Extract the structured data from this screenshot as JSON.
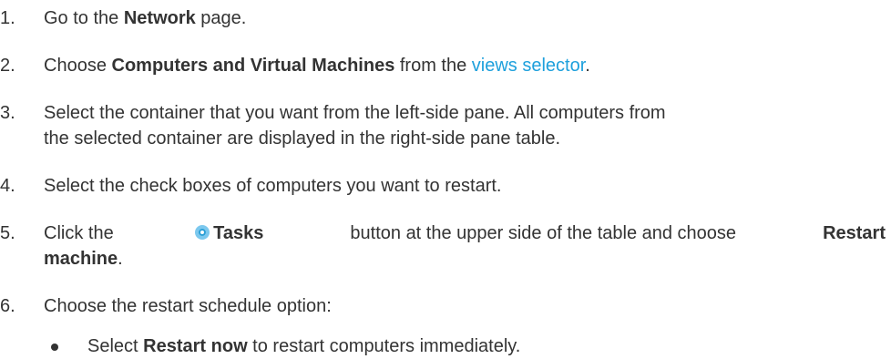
{
  "steps": [
    {
      "num": "1.",
      "pre": "Go to the ",
      "bold": "Network",
      "post": " page."
    },
    {
      "num": "2.",
      "pre": "Choose ",
      "bold": "Computers and Virtual Machines",
      "mid": " from the ",
      "link": "views selector",
      "post": "."
    },
    {
      "num": "3.",
      "line1": "Select the container that you want from the left-side pane. All computers from",
      "line2": "the selected container are displayed in the right-side pane table."
    },
    {
      "num": "4.",
      "text": "Select the check boxes of computers you want to restart."
    },
    {
      "num": "5.",
      "pre": "Click the",
      "icon": "tasks-icon",
      "bold1": "Tasks",
      "mid": " button at the upper side of the table and choose ",
      "bold2a": "Restart",
      "bold2b": "machine",
      "post": "."
    },
    {
      "num": "6.",
      "text": "Choose the restart schedule option:"
    }
  ],
  "bullets": [
    {
      "pre": "Select ",
      "bold": "Restart now",
      "post": " to restart computers immediately."
    }
  ],
  "colors": {
    "text": "#333333",
    "link": "#1ea0dc",
    "icon": "#2a9fd6"
  }
}
